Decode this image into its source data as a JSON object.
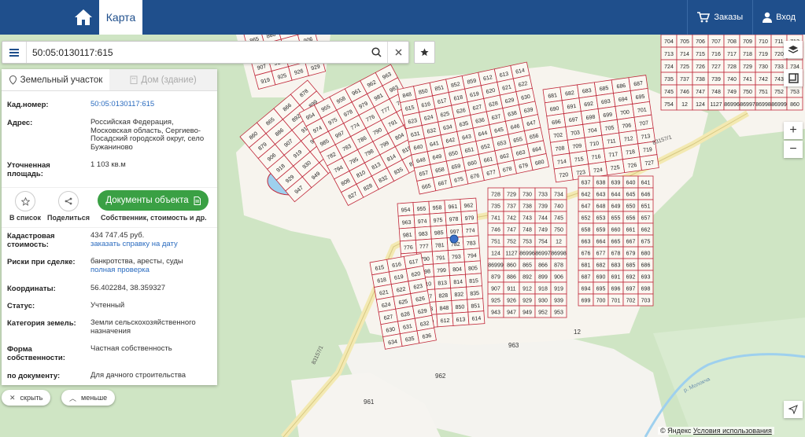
{
  "header": {
    "tab_map": "Карта",
    "orders": "Заказы",
    "login": "Вход",
    "color": "#1f4f8c"
  },
  "search": {
    "value": "50:05:0130117:615",
    "menu_icon": "hamburger-icon",
    "search_icon": "magnifier-icon",
    "clear_icon": "close-icon",
    "bookmark_icon": "star-icon"
  },
  "panel": {
    "tab_land": "Земельный участок",
    "tab_building": "Дом (здание)",
    "cad_number_label": "Кад.номер:",
    "cad_number": "50:05:0130117:615",
    "address_label": "Адрес:",
    "address": "Российская Федерация, Московская область, Сергиево-Посадский городской округ, село Бужаниново",
    "area_label": "Уточненная площадь:",
    "area": "1 103 кв.м",
    "action_list": "В список",
    "action_share": "Поделиться",
    "doc_button": "Документы объекта",
    "doc_caption": "Собственник, стоимость и др.",
    "cad_value_label": "Кадастровая стоимость:",
    "cad_value": "434 747.45 руб.",
    "cad_value_link": "заказать справку на дату",
    "risks_label": "Риски при сделке:",
    "risks": "банкротства, аресты, суды",
    "risks_link": "полная проверка",
    "coords_label": "Координаты:",
    "coords": "56.402284, 38.359327",
    "status_label": "Статус:",
    "status": "Учтенный",
    "category_label": "Категория земель:",
    "category": "Земли сельскохозяйственного назначения",
    "ownership_label": "Форма собственности:",
    "ownership": "Частная собственность",
    "doc_use_label": "по документу:",
    "doc_use": "Для дачного строительства"
  },
  "bottom": {
    "hide": "скрыть",
    "less": "меньше"
  },
  "map": {
    "road_label": "83157/1",
    "river_label": "р. Молокча",
    "attribution_brand": "© Яндекс",
    "attribution_terms": "Условия использования",
    "parcel_labels": [
      "860",
      "865",
      "866",
      "878",
      "879",
      "886",
      "892",
      "899",
      "906",
      "907",
      "911",
      "912",
      "918",
      "919",
      "925",
      "926",
      "929",
      "930",
      "939",
      "943",
      "947",
      "949",
      "952",
      "953",
      "954",
      "955",
      "958",
      "961",
      "962",
      "963",
      "974",
      "975",
      "978",
      "979",
      "981",
      "983",
      "985",
      "997",
      "774",
      "776",
      "777",
      "781",
      "782",
      "783",
      "786",
      "790",
      "791",
      "793",
      "794",
      "795",
      "798",
      "799",
      "804",
      "805",
      "808",
      "810",
      "813",
      "814",
      "815",
      "826",
      "827",
      "828",
      "832",
      "835",
      "839",
      "843",
      "848",
      "850",
      "851",
      "852",
      "859",
      "612",
      "613",
      "614",
      "615",
      "616",
      "617",
      "618",
      "619",
      "620",
      "621",
      "622",
      "623",
      "624",
      "625",
      "626",
      "627",
      "628",
      "629",
      "630",
      "631",
      "632",
      "634",
      "635",
      "636",
      "637",
      "638",
      "639",
      "640",
      "641",
      "642",
      "643",
      "644",
      "645",
      "646",
      "647",
      "648",
      "649",
      "650",
      "651",
      "652",
      "653",
      "655",
      "656",
      "657",
      "658",
      "659",
      "660",
      "661",
      "662",
      "663",
      "664",
      "665",
      "667",
      "675",
      "676",
      "677",
      "678",
      "679",
      "680",
      "681",
      "682",
      "683",
      "685",
      "686",
      "687",
      "690",
      "691",
      "692",
      "693",
      "694",
      "695",
      "696",
      "697",
      "698",
      "699",
      "700",
      "701",
      "702",
      "703",
      "704",
      "705",
      "706",
      "707",
      "708",
      "709",
      "710",
      "711",
      "712",
      "713",
      "714",
      "715",
      "716",
      "717",
      "718",
      "719",
      "720",
      "723",
      "724",
      "725",
      "726",
      "727",
      "728",
      "729",
      "730",
      "733",
      "734",
      "735",
      "737",
      "738",
      "739",
      "740",
      "741",
      "742",
      "743",
      "744",
      "745",
      "746",
      "747",
      "748",
      "749",
      "750",
      "751",
      "752",
      "753",
      "754",
      "12",
      "124",
      "1127",
      "86996",
      "86997",
      "86998",
      "86999"
    ],
    "road_color": "#f3e9b2",
    "parcel_stroke": "#c0283a",
    "forest_color": "#cfe5c4"
  }
}
